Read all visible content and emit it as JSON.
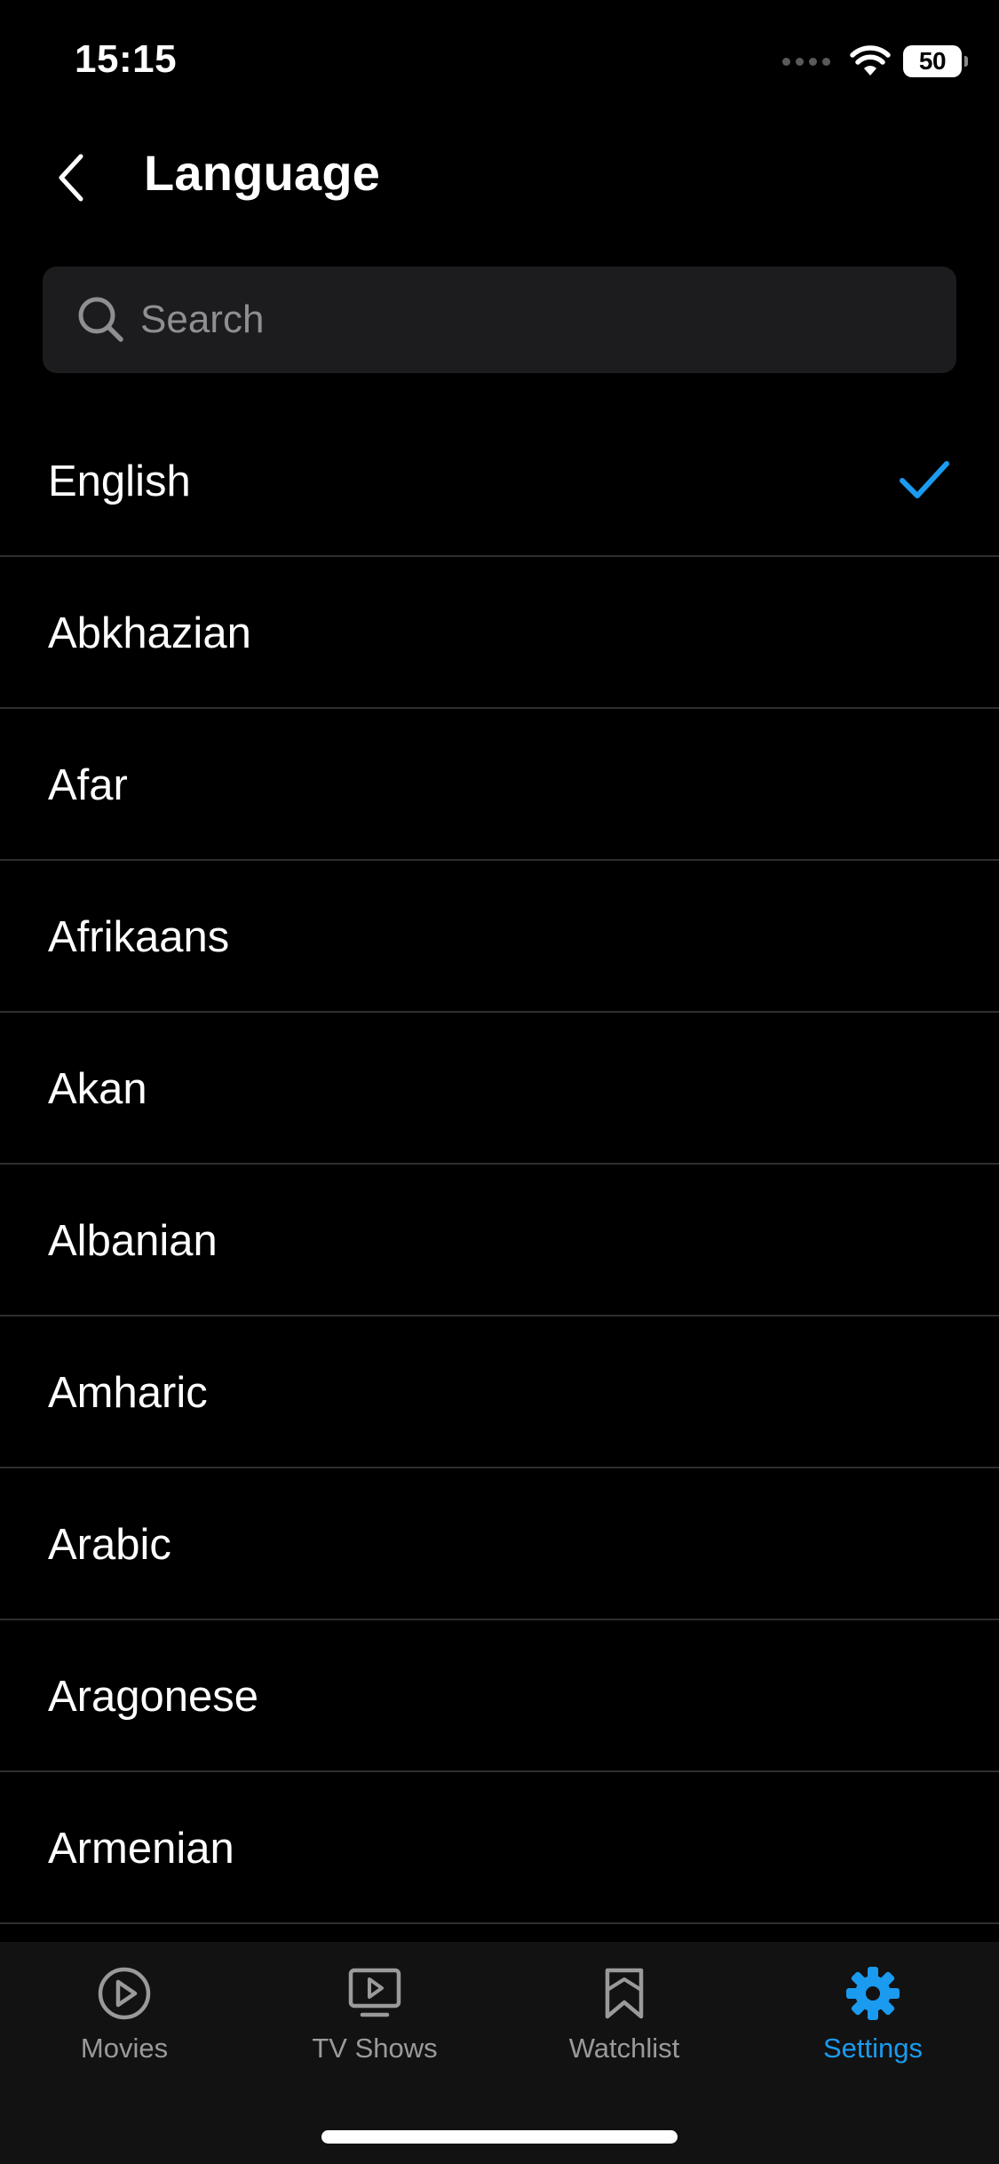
{
  "status_bar": {
    "time": "15:15",
    "battery": "50"
  },
  "header": {
    "title": "Language"
  },
  "search": {
    "placeholder": "Search",
    "value": ""
  },
  "languages": [
    {
      "label": "English",
      "selected": true
    },
    {
      "label": "Abkhazian",
      "selected": false
    },
    {
      "label": "Afar",
      "selected": false
    },
    {
      "label": "Afrikaans",
      "selected": false
    },
    {
      "label": "Akan",
      "selected": false
    },
    {
      "label": "Albanian",
      "selected": false
    },
    {
      "label": "Amharic",
      "selected": false
    },
    {
      "label": "Arabic",
      "selected": false
    },
    {
      "label": "Aragonese",
      "selected": false
    },
    {
      "label": "Armenian",
      "selected": false
    }
  ],
  "tabs": [
    {
      "label": "Movies",
      "icon": "play-circle-icon",
      "active": false
    },
    {
      "label": "TV Shows",
      "icon": "tv-play-icon",
      "active": false
    },
    {
      "label": "Watchlist",
      "icon": "bookmark-icon",
      "active": false
    },
    {
      "label": "Settings",
      "icon": "gear-icon",
      "active": true
    }
  ],
  "colors": {
    "accent": "#1a9bef",
    "background": "#000000",
    "search_background": "#1c1c1e",
    "tab_bar_background": "#121212",
    "inactive_tab": "#9a9a9a",
    "divider": "#2e2e2e"
  }
}
